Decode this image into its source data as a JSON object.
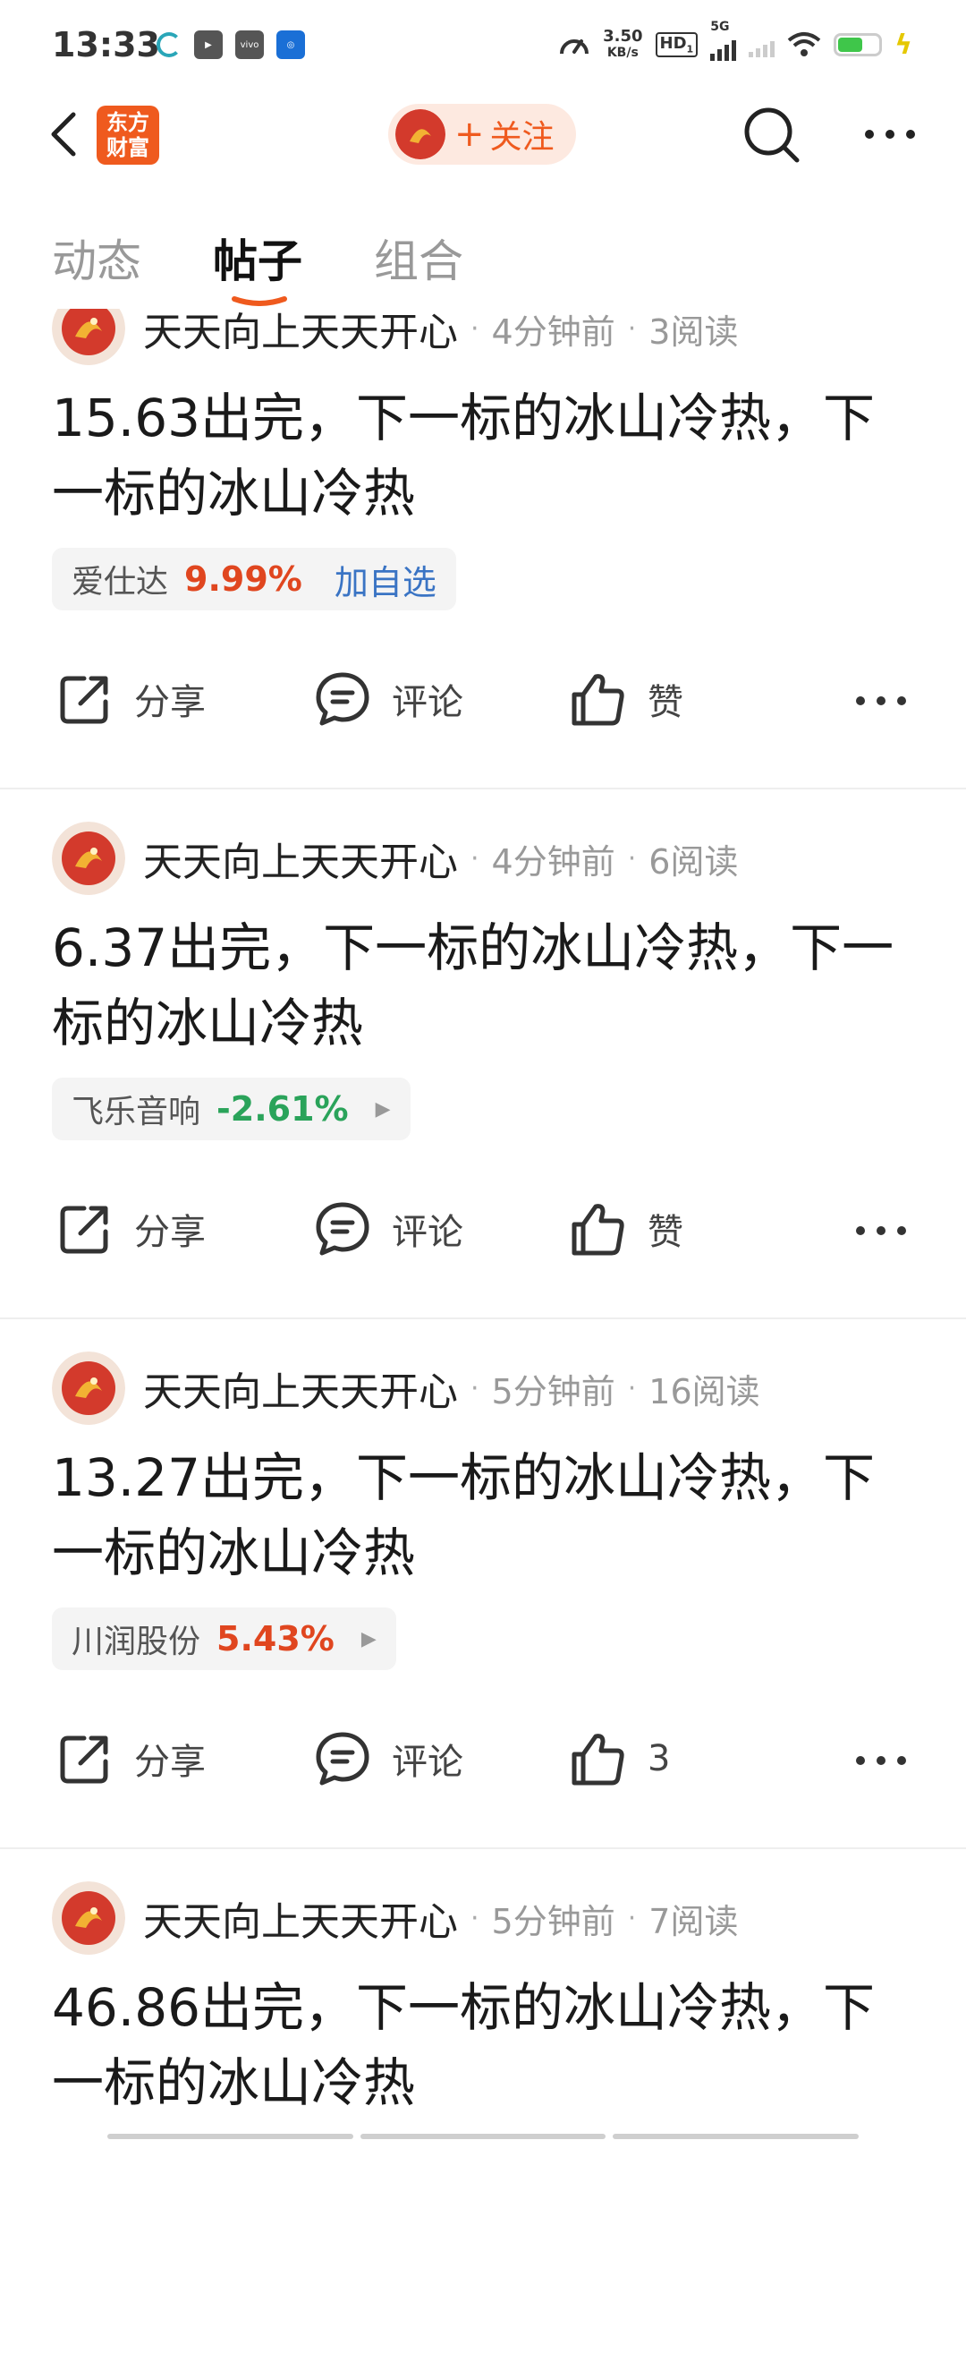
{
  "status_bar": {
    "time": "13:33",
    "net_speed_value": "3.50",
    "net_speed_unit": "KB/s",
    "hd_label": "HD",
    "hd_sub": "1",
    "network": "5G",
    "battery_level": 0.6
  },
  "header": {
    "logo_line1": "东方",
    "logo_line2": "财富",
    "follow_label": "关注",
    "follow_plus": "+"
  },
  "tabs": [
    {
      "label": "动态",
      "active": false
    },
    {
      "label": "帖子",
      "active": true
    },
    {
      "label": "组合",
      "active": false
    }
  ],
  "posts": [
    {
      "author": "天天向上天天开心",
      "time": "4分钟前",
      "reads": "3阅读",
      "content": "15.63出完，下一标的冰山冷热，下一标的冰山冷热",
      "stock_name": "爱仕达",
      "stock_pct": "9.99%",
      "stock_color": "#e0461f",
      "stock_extra": "加自选",
      "share": "分享",
      "comment": "评论",
      "like": "赞"
    },
    {
      "author": "天天向上天天开心",
      "time": "4分钟前",
      "reads": "6阅读",
      "content": "6.37出完，下一标的冰山冷热，下一标的冰山冷热",
      "stock_name": "飞乐音响",
      "stock_pct": "-2.61%",
      "stock_color": "#2aa35a",
      "share": "分享",
      "comment": "评论",
      "like": "赞"
    },
    {
      "author": "天天向上天天开心",
      "time": "5分钟前",
      "reads": "16阅读",
      "content": "13.27出完，下一标的冰山冷热，下一标的冰山冷热",
      "stock_name": "川润股份",
      "stock_pct": "5.43%",
      "stock_color": "#e0461f",
      "share": "分享",
      "comment": "评论",
      "like": "3"
    },
    {
      "author": "天天向上天天开心",
      "time": "5分钟前",
      "reads": "7阅读",
      "content": "46.86出完，下一标的冰山冷热，下一标的冰山冷热"
    }
  ],
  "colors": {
    "accent": "#ef5a1e",
    "up": "#e0461f",
    "down": "#2aa35a",
    "link": "#3a74c4"
  }
}
